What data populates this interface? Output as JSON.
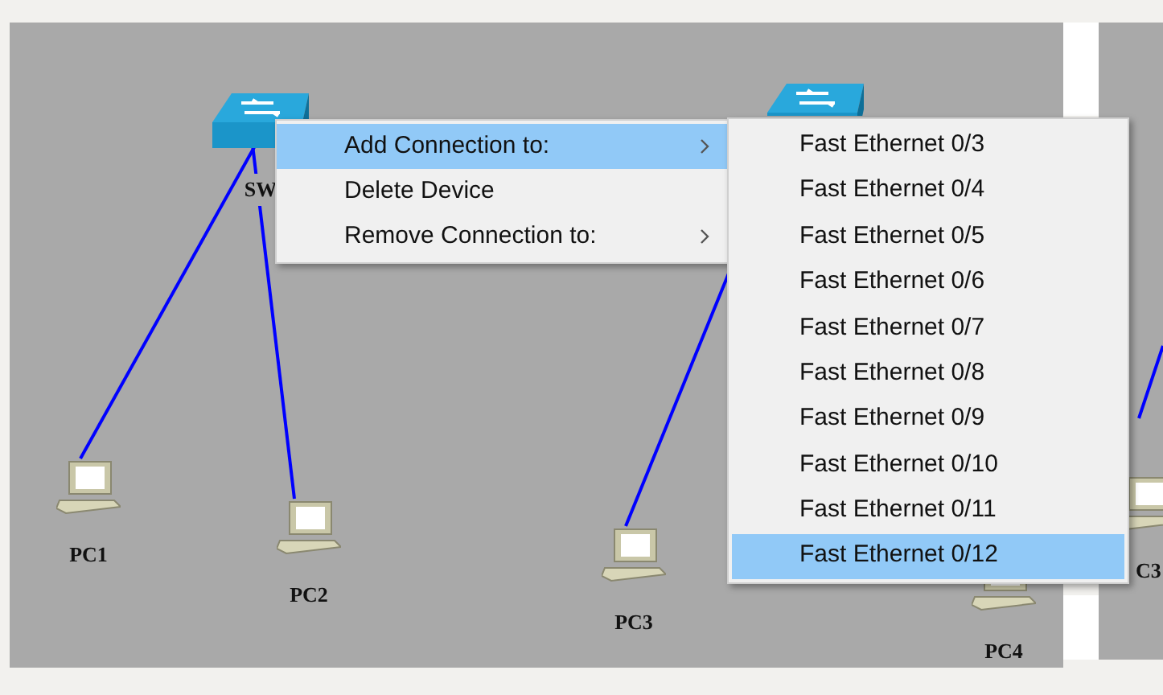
{
  "canvas": {
    "devices": [
      {
        "kind": "switch",
        "label": "SW"
      },
      {
        "kind": "switch"
      },
      {
        "kind": "pc",
        "label": "PC1"
      },
      {
        "kind": "pc",
        "label": "PC2"
      },
      {
        "kind": "pc",
        "label": "PC3"
      },
      {
        "kind": "pc",
        "label": "PC4"
      },
      {
        "kind": "pc",
        "label": "C3"
      }
    ]
  },
  "context_menu": {
    "items": [
      {
        "label": "Add Connection to:",
        "selected": true,
        "submenu": true
      },
      {
        "label": "Delete Device",
        "selected": false,
        "submenu": false
      },
      {
        "label": "Remove Connection to:",
        "selected": false,
        "submenu": true
      }
    ]
  },
  "submenu": {
    "items": [
      {
        "label": "Fast Ethernet 0/3",
        "selected": false
      },
      {
        "label": "Fast Ethernet 0/4",
        "selected": false
      },
      {
        "label": "Fast Ethernet 0/5",
        "selected": false
      },
      {
        "label": "Fast Ethernet 0/6",
        "selected": false
      },
      {
        "label": "Fast Ethernet 0/7",
        "selected": false
      },
      {
        "label": "Fast Ethernet 0/8",
        "selected": false
      },
      {
        "label": "Fast Ethernet 0/9",
        "selected": false
      },
      {
        "label": "Fast Ethernet 0/10",
        "selected": false
      },
      {
        "label": "Fast Ethernet 0/11",
        "selected": false
      },
      {
        "label": "Fast Ethernet 0/12",
        "selected": true
      }
    ]
  }
}
